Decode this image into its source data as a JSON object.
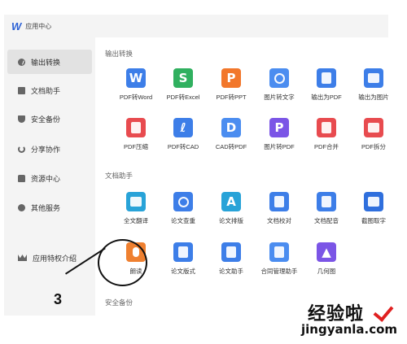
{
  "window": {
    "title": "应用中心"
  },
  "sidebar": {
    "items": [
      {
        "label": "输出转换",
        "icon": "output-icon",
        "active": true
      },
      {
        "label": "文档助手",
        "icon": "doc-icon",
        "active": false
      },
      {
        "label": "安全备份",
        "icon": "shield-icon",
        "active": false
      },
      {
        "label": "分享协作",
        "icon": "share-icon",
        "active": false
      },
      {
        "label": "资源中心",
        "icon": "resource-icon",
        "active": false
      },
      {
        "label": "其他服务",
        "icon": "more-icon",
        "active": false
      },
      {
        "label": "应用特权介绍",
        "icon": "crown-icon",
        "active": false
      }
    ]
  },
  "sections": {
    "output": {
      "title": "输出转换",
      "apps": [
        {
          "label": "PDF转Word",
          "icon": "pdf-to-word-icon",
          "color": "#3d7ee8"
        },
        {
          "label": "PDF转Excel",
          "icon": "pdf-to-excel-icon",
          "color": "#30b05f"
        },
        {
          "label": "PDF转PPT",
          "icon": "pdf-to-ppt-icon",
          "color": "#f2772b"
        },
        {
          "label": "图片转文字",
          "icon": "image-to-text-icon",
          "color": "#4b8df0"
        },
        {
          "label": "输出为PDF",
          "icon": "export-pdf-icon",
          "color": "#3d7ee8"
        },
        {
          "label": "输出为图片",
          "icon": "export-image-icon",
          "color": "#3d7ee8"
        },
        {
          "label": "PDF压缩",
          "icon": "pdf-compress-icon",
          "color": "#e84b4f"
        },
        {
          "label": "PDF转CAD",
          "icon": "pdf-to-cad-icon",
          "color": "#3d7ee8"
        },
        {
          "label": "CAD转PDF",
          "icon": "cad-to-pdf-icon",
          "color": "#4b8df0"
        },
        {
          "label": "图片转PDF",
          "icon": "image-to-pdf-icon",
          "color": "#7b55e6"
        },
        {
          "label": "PDF合并",
          "icon": "pdf-merge-icon",
          "color": "#e84b4f"
        },
        {
          "label": "PDF拆分",
          "icon": "pdf-split-icon",
          "color": "#e84b4f"
        }
      ]
    },
    "doc_assistant": {
      "title": "文档助手",
      "apps": [
        {
          "label": "全文翻译",
          "icon": "translate-icon",
          "color": "#28a3d8"
        },
        {
          "label": "论文查重",
          "icon": "plagiarism-check-icon",
          "color": "#3d7ee8"
        },
        {
          "label": "论文排版",
          "icon": "paper-format-icon",
          "color": "#28a3d8"
        },
        {
          "label": "文档校对",
          "icon": "proofread-icon",
          "color": "#3d7ee8"
        },
        {
          "label": "文档配音",
          "icon": "doc-voice-icon",
          "color": "#3d7ee8"
        },
        {
          "label": "截图取字",
          "icon": "screenshot-text-icon",
          "color": "#2f6fdd"
        },
        {
          "label": "朗读",
          "icon": "microphone-icon",
          "color": "#ef8030"
        },
        {
          "label": "论文版式",
          "icon": "paper-layout-icon",
          "color": "#3d7ee8"
        },
        {
          "label": "论文助手",
          "icon": "paper-assistant-icon",
          "color": "#3d7ee8"
        },
        {
          "label": "合同管理助手",
          "icon": "contract-icon",
          "color": "#4b8df0"
        },
        {
          "label": "几何图",
          "icon": "geometry-icon",
          "color": "#7b55e6"
        }
      ]
    },
    "security": {
      "title": "安全备份"
    }
  },
  "annotation": {
    "number": "3"
  },
  "watermark": {
    "cn": "经验啦",
    "en": "jingyanla.com"
  }
}
